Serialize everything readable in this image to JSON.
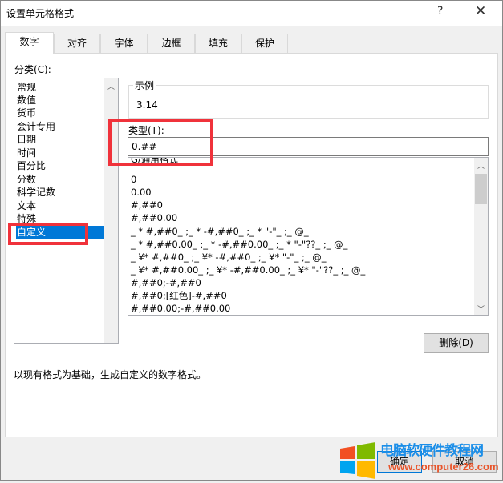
{
  "window": {
    "title": "设置单元格格式",
    "help": "?",
    "close": "✕"
  },
  "tabs": [
    "数字",
    "对齐",
    "字体",
    "边框",
    "填充",
    "保护"
  ],
  "category": {
    "label": "分类(C):",
    "items": [
      "常规",
      "数值",
      "货币",
      "会计专用",
      "日期",
      "时间",
      "百分比",
      "分数",
      "科学记数",
      "文本",
      "特殊",
      "自定义"
    ],
    "selected": "自定义"
  },
  "sample": {
    "label": "示例",
    "value": "3.14"
  },
  "type": {
    "label": "类型(T):",
    "value": "0.##"
  },
  "formats": [
    "G/通用格式",
    "0",
    "0.00",
    "#,##0",
    "#,##0.00",
    "_ * #,##0_ ;_ * -#,##0_ ;_ * \"-\"_ ;_ @_",
    "_ * #,##0.00_ ;_ * -#,##0.00_ ;_ * \"-\"??_ ;_ @_",
    "_ ¥* #,##0_ ;_ ¥* -#,##0_ ;_ ¥* \"-\"_ ;_ @_",
    "_ ¥* #,##0.00_ ;_ ¥* -#,##0.00_ ;_ ¥* \"-\"??_ ;_ @_",
    "#,##0;-#,##0",
    "#,##0;[红色]-#,##0",
    "#,##0.00;-#,##0.00"
  ],
  "buttons": {
    "delete": "删除(D)",
    "ok": "确定",
    "cancel": "取消"
  },
  "description": "以现有格式为基础，生成自定义的数字格式。",
  "watermark": {
    "title": "电脑软硬件教程网",
    "url": "www.computer26.com"
  }
}
